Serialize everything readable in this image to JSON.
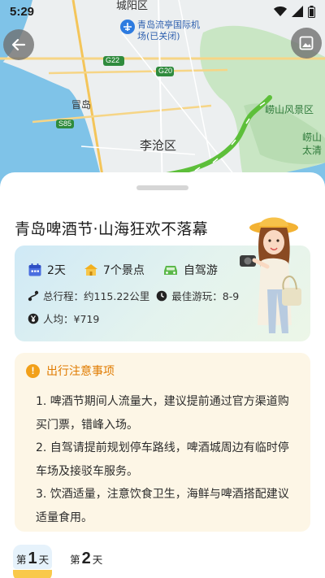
{
  "status_bar": {
    "time": "5:29"
  },
  "map": {
    "labels": {
      "chengyang": "城阳区",
      "airport_line1": "青岛流亭国际机",
      "airport_line2": "场(已关闭)",
      "g22": "G22",
      "g20": "G20",
      "maodao": "冒岛",
      "s85": "S85",
      "licang": "李沧区",
      "laoshan_scenic": "崂山风景区",
      "laoshan_line1": "崂山",
      "laoshan_line2": "太清"
    }
  },
  "trip": {
    "title": "青岛啤酒节·山海狂欢不落幕",
    "days": "2天",
    "spots": "7个景点",
    "mode": "自驾游",
    "distance": "总行程：约115.22公里",
    "best_time": "最佳游玩：8-9",
    "per_person": "人均：¥719"
  },
  "notice": {
    "title": "出行注意事项",
    "items": [
      "1. 啤酒节期间人流量大，建议提前通过官方渠道购买门票，错峰入场。",
      "2. 自驾请提前规划停车路线，啤酒城周边有临时停车场及接驳车服务。",
      "3. 饮酒适量，注意饮食卫生，海鲜与啤酒搭配建议适量食用。"
    ]
  },
  "day_tabs": [
    {
      "prefix": "第",
      "num": "1",
      "suffix": "天",
      "active": true
    },
    {
      "prefix": "第",
      "num": "2",
      "suffix": "天",
      "active": false
    }
  ],
  "colors": {
    "accent_orange": "#e07b00",
    "route_green": "#5dbf3a",
    "tab_yellow": "#f9c94b"
  },
  "icons": [
    "back-arrow-icon",
    "photo-icon",
    "calendar-icon",
    "car-icon",
    "route-icon",
    "clock-icon",
    "yen-icon",
    "warning-icon",
    "airport-icon",
    "wifi-icon",
    "signal-icon",
    "battery-icon"
  ]
}
